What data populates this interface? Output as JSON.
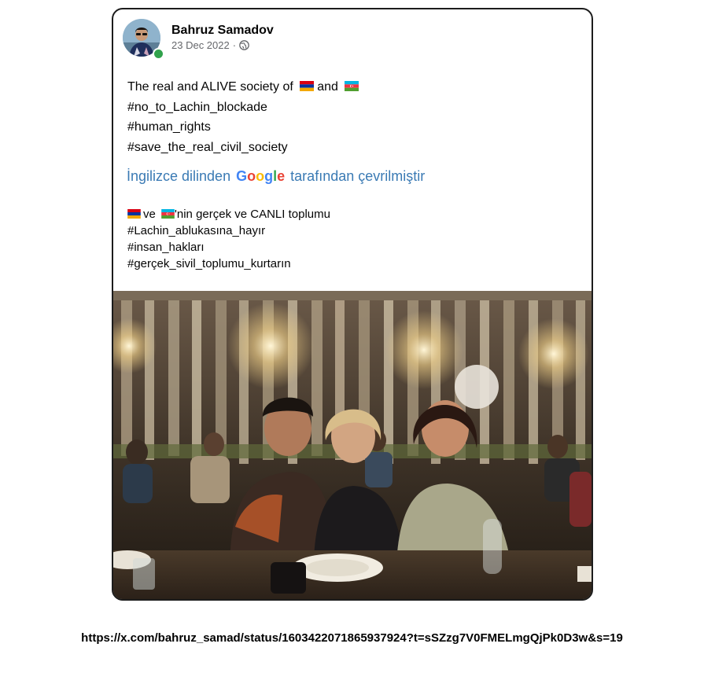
{
  "post": {
    "author": "Bahruz Samadov",
    "date": "23 Dec 2022",
    "separator": "·",
    "online_status": "online",
    "text": {
      "line1_before": "The real and ALIVE society of",
      "line1_mid": "and",
      "hashtag1": "#no_to_Lachin_blockade",
      "hashtag2": "#human_rights",
      "hashtag3": "#save_the_real_civil_society"
    },
    "translation_notice": {
      "before": "İngilizce dilinden",
      "brand": "Google",
      "after": "tarafından çevrilmiştir"
    },
    "translation": {
      "line1_mid": "ve",
      "line1_after": "'nin gerçek ve CANLI toplumu",
      "hashtag1": "#Lachin_ablukasına_hayır",
      "hashtag2": "#insan_hakları",
      "hashtag3": "#gerçek_sivil_toplumu_kurtarın"
    },
    "flags": [
      "flag-armenia-icon",
      "flag-azerbaijan-icon"
    ],
    "photo": "group-photo-restaurant"
  },
  "source_url": "https://x.com/bahruz_samad/status/1603422071865937924?t=sSZzg7V0FMELmgQjPk0D3w&s=19",
  "colors": {
    "link_blue": "#3a7ab4",
    "online_green": "#31a24c",
    "meta_gray": "#65676b"
  }
}
